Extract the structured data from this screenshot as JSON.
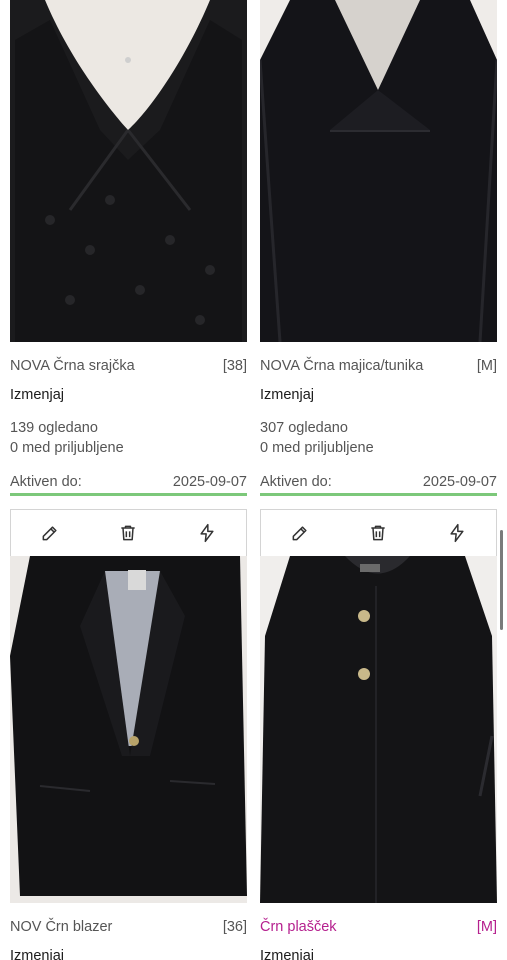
{
  "listings": [
    {
      "title": "NOVA Črna srajčka",
      "size": "[38]",
      "edit_label": "Izmenjaj",
      "views": "139 ogledano",
      "favorites": "0 med priljubljene",
      "active_label": "Aktiven do:",
      "active_date": "2025-09-07"
    },
    {
      "title": "NOVA Črna majica/tunika",
      "size": "[M]",
      "edit_label": "Izmenjaj",
      "views": "307 ogledano",
      "favorites": "0 med priljubljene",
      "active_label": "Aktiven do:",
      "active_date": "2025-09-07"
    },
    {
      "title": "NOV Črn blazer",
      "size": "[36]",
      "edit_label": "Izmenjaj"
    },
    {
      "title": "Črn plašček",
      "size": "[M]",
      "edit_label": "Izmenjaj",
      "highlight_color": "#b5208e"
    }
  ],
  "toolbar_icons": [
    "pencil-icon",
    "trash-icon",
    "lightning-icon"
  ],
  "colors": {
    "active_underline": "#7cc87a",
    "highlight": "#b5208e"
  }
}
